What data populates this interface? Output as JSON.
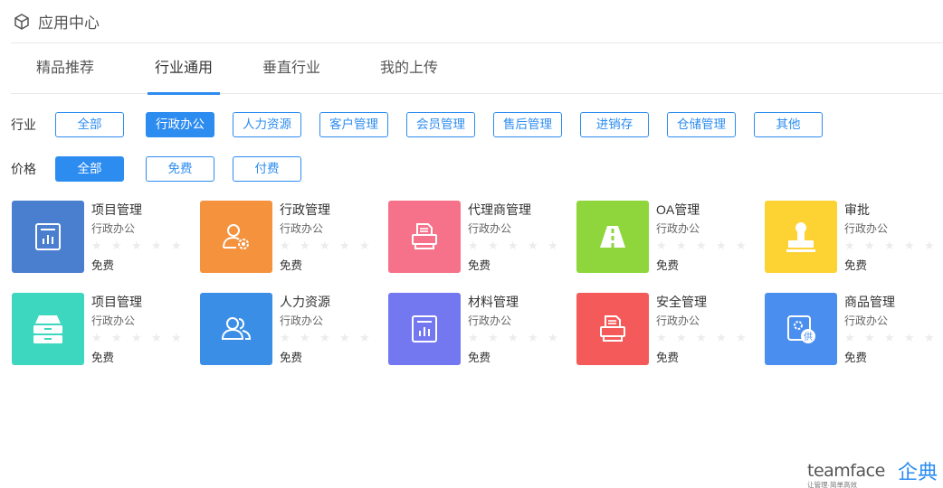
{
  "header": {
    "title": "应用中心",
    "icon": "cube-icon"
  },
  "tabs": [
    {
      "label": "精品推荐"
    },
    {
      "label": "行业通用",
      "active": true
    },
    {
      "label": "垂直行业"
    },
    {
      "label": "我的上传"
    }
  ],
  "filters": {
    "industry": {
      "label": "行业",
      "options": [
        "全部",
        "行政办公",
        "人力资源",
        "客户管理",
        "会员管理",
        "售后管理",
        "进销存",
        "仓储管理",
        "其他"
      ],
      "selected": "行政办公"
    },
    "price": {
      "label": "价格",
      "options": [
        "全部",
        "免费",
        "付费"
      ],
      "selected": "全部"
    }
  },
  "apps": [
    {
      "name": "项目管理",
      "category": "行政办公",
      "price": "免费",
      "color": "#4a7fd0",
      "icon": "chart-document-icon",
      "rating": 0
    },
    {
      "name": "行政管理",
      "category": "行政办公",
      "price": "免费",
      "color": "#f5923e",
      "icon": "user-gear-icon",
      "rating": 0
    },
    {
      "name": "代理商管理",
      "category": "行政办公",
      "price": "免费",
      "color": "#f6728a",
      "icon": "printer-icon",
      "rating": 0
    },
    {
      "name": "OA管理",
      "category": "行政办公",
      "price": "免费",
      "color": "#8ed63c",
      "icon": "road-icon",
      "rating": 0
    },
    {
      "name": "审批",
      "category": "行政办公",
      "price": "免费",
      "color": "#fdd233",
      "icon": "stamp-icon",
      "rating": 0
    },
    {
      "name": "项目管理",
      "category": "行政办公",
      "price": "免费",
      "color": "#3dd7c0",
      "icon": "drawer-cabinet-icon",
      "rating": 0
    },
    {
      "name": "人力资源",
      "category": "行政办公",
      "price": "免费",
      "color": "#3b8ee6",
      "icon": "users-icon",
      "rating": 0
    },
    {
      "name": "材料管理",
      "category": "行政办公",
      "price": "免费",
      "color": "#7377f0",
      "icon": "chart-document-icon",
      "rating": 0
    },
    {
      "name": "安全管理",
      "category": "行政办公",
      "price": "免费",
      "color": "#f55a5a",
      "icon": "printer-icon",
      "rating": 0
    },
    {
      "name": "商品管理",
      "category": "行政办公",
      "price": "免费",
      "color": "#4a8ff0",
      "icon": "supplier-icon",
      "rating": 0
    }
  ],
  "logo": {
    "latin": "teamface",
    "cn": "企典",
    "slogan": "让管理·简单高效"
  },
  "colors": {
    "accent": "#2d8cf0",
    "border": "#e8e8e8",
    "star_empty": "#ececec"
  }
}
